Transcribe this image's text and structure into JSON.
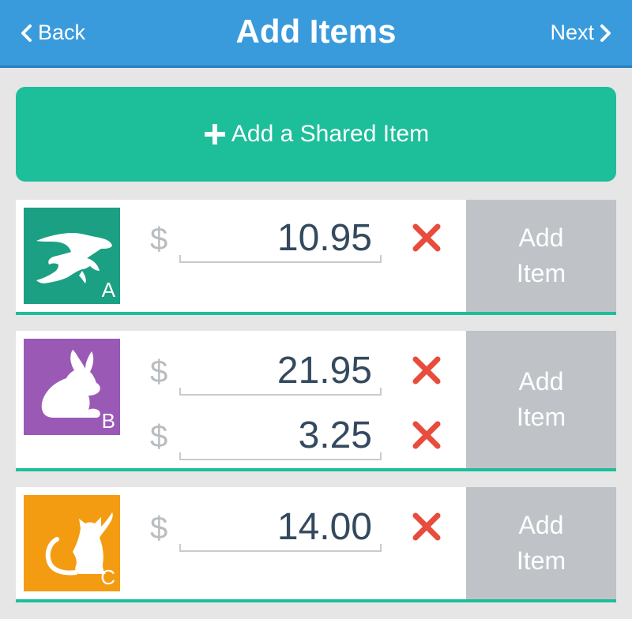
{
  "nav": {
    "back_label": "Back",
    "title": "Add Items",
    "next_label": "Next"
  },
  "shared_button_label": "Add a Shared Item",
  "currency_symbol": "$",
  "add_item_label_line1": "Add",
  "add_item_label_line2": "Item",
  "colors": {
    "header": "#3a9bdc",
    "shared_button": "#1dbe9a",
    "remove": "#e74c3c",
    "add_item": "#bfc3c7"
  },
  "people": [
    {
      "letter": "A",
      "avatar_icon": "alligator-icon",
      "color": "#1ba084",
      "amounts": [
        "10.95"
      ]
    },
    {
      "letter": "B",
      "avatar_icon": "rabbit-icon",
      "color": "#9b59b6",
      "amounts": [
        "21.95",
        "3.25"
      ]
    },
    {
      "letter": "C",
      "avatar_icon": "cat-icon",
      "color": "#f39c12",
      "amounts": [
        "14.00"
      ]
    }
  ]
}
